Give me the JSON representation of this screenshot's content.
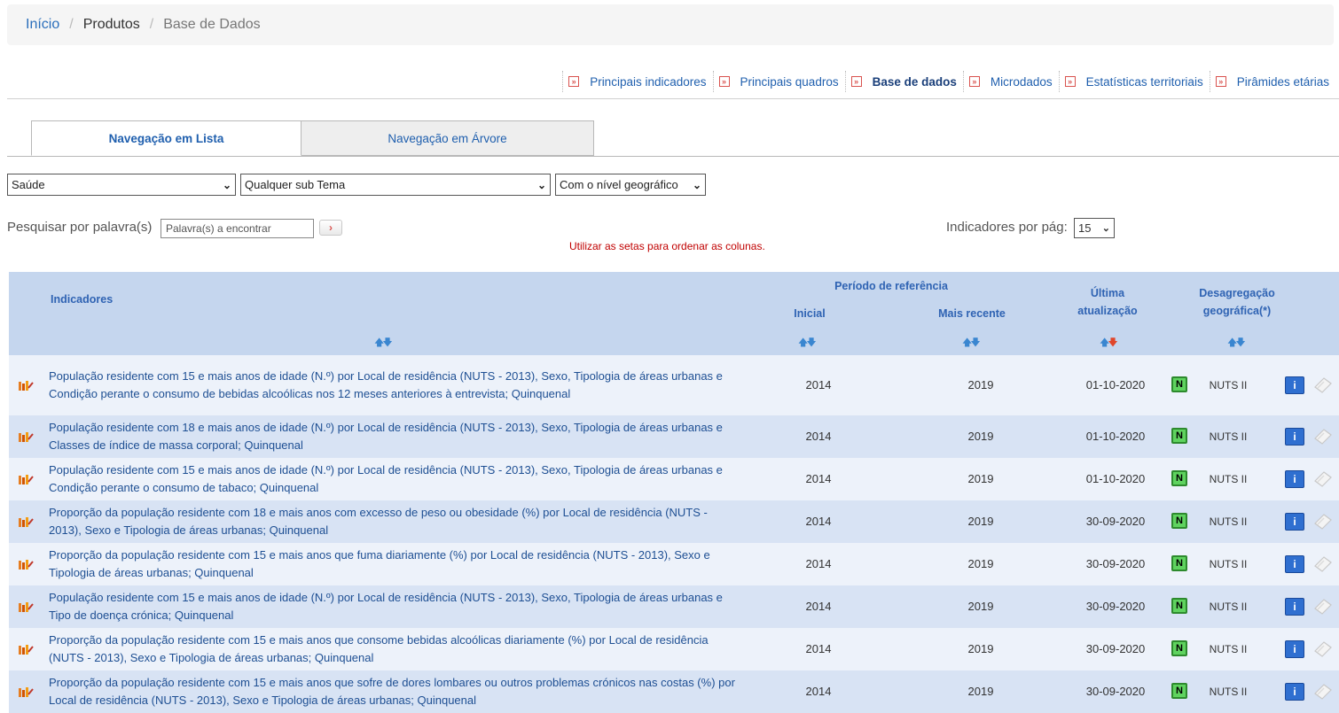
{
  "breadcrumb": {
    "home": "Início",
    "sep": "/",
    "products": "Produtos",
    "current": "Base de Dados"
  },
  "product_nav": {
    "marker": "»",
    "items": [
      {
        "label": "Principais indicadores",
        "active": false
      },
      {
        "label": "Principais quadros",
        "active": false
      },
      {
        "label": "Base de dados",
        "active": true
      },
      {
        "label": "Microdados",
        "active": false
      },
      {
        "label": "Estatísticas territoriais",
        "active": false
      },
      {
        "label": "Pirâmides etárias",
        "active": false
      }
    ]
  },
  "tabs": {
    "list": "Navegação em Lista",
    "tree": "Navegação em Árvore"
  },
  "filters": {
    "theme": "Saúde",
    "subtheme": "Qualquer sub Tema",
    "geo_level": "Com o nível geográfico"
  },
  "search": {
    "label": "Pesquisar por palavra(s)",
    "placeholder": "Palavra(s) a encontrar",
    "button": "›"
  },
  "hint": "Utilizar as setas para ordenar as colunas.",
  "per_page": {
    "label": "Indicadores por pág:",
    "value": "15"
  },
  "table": {
    "headers": {
      "indicators": "Indicadores",
      "period": "Período de referência",
      "initial": "Inicial",
      "recent": "Mais recente",
      "updated": "Última atualização",
      "disaggregation": "Desagregação geográfica(*)"
    },
    "sort_up": "🡅",
    "sort_down": "🡇",
    "badge": "N",
    "info": "i",
    "rows": [
      {
        "desc": "População residente com 15 e mais anos de idade (N.º) por Local de residência (NUTS - 2013), Sexo, Tipologia de áreas urbanas e Condição perante o consumo de bebidas alcoólicas nos 12 meses anteriores à entrevista; Quinquenal",
        "initial": "2014",
        "recent": "2019",
        "updated": "01-10-2020",
        "geo": "NUTS II"
      },
      {
        "desc": "População residente com 18 e mais anos de idade (N.º) por Local de residência (NUTS - 2013), Sexo, Tipologia de áreas urbanas e Classes de índice de massa corporal; Quinquenal",
        "initial": "2014",
        "recent": "2019",
        "updated": "01-10-2020",
        "geo": "NUTS II"
      },
      {
        "desc": "População residente com 15 e mais anos de idade (N.º) por Local de residência (NUTS - 2013), Sexo, Tipologia de áreas urbanas e Condição perante o consumo de tabaco; Quinquenal",
        "initial": "2014",
        "recent": "2019",
        "updated": "01-10-2020",
        "geo": "NUTS II"
      },
      {
        "desc": "Proporção da população residente com 18 e mais anos com excesso de peso ou obesidade (%) por Local de residência (NUTS - 2013), Sexo e Tipologia de áreas urbanas; Quinquenal",
        "initial": "2014",
        "recent": "2019",
        "updated": "30-09-2020",
        "geo": "NUTS II"
      },
      {
        "desc": "Proporção da população residente com 15 e mais anos que fuma diariamente (%) por Local de residência (NUTS - 2013), Sexo e Tipologia de áreas urbanas; Quinquenal",
        "initial": "2014",
        "recent": "2019",
        "updated": "30-09-2020",
        "geo": "NUTS II"
      },
      {
        "desc": "População residente com 15 e mais anos de idade (N.º) por Local de residência (NUTS - 2013), Sexo, Tipologia de áreas urbanas e Tipo de doença crónica; Quinquenal",
        "initial": "2014",
        "recent": "2019",
        "updated": "30-09-2020",
        "geo": "NUTS II"
      },
      {
        "desc": "Proporção da população residente com 15 e mais anos que consome bebidas alcoólicas diariamente (%) por Local de residência (NUTS - 2013), Sexo e Tipologia de áreas urbanas; Quinquenal",
        "initial": "2014",
        "recent": "2019",
        "updated": "30-09-2020",
        "geo": "NUTS II"
      },
      {
        "desc": "Proporção da população residente com 15 e mais anos que sofre de dores lombares ou outros problemas crónicos nas costas (%) por Local de residência (NUTS - 2013), Sexo e Tipologia de áreas urbanas; Quinquenal",
        "initial": "2014",
        "recent": "2019",
        "updated": "30-09-2020",
        "geo": "NUTS II"
      }
    ]
  }
}
